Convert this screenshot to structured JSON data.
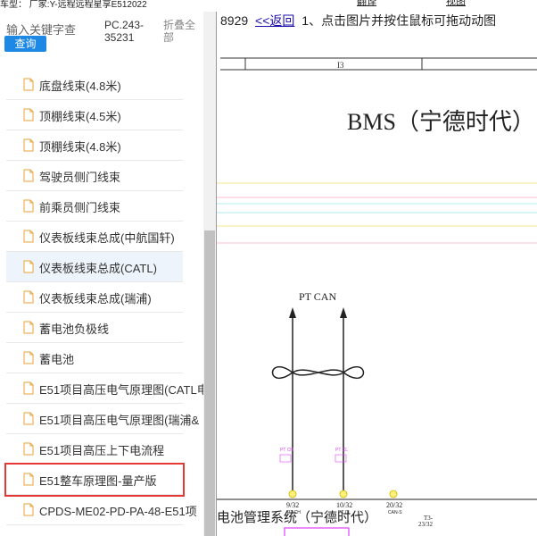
{
  "topbar": {
    "car_model": "车型： 厂家:Y-远程远程星享E512022",
    "link_a": "翻译",
    "link_b": "视图"
  },
  "search": {
    "placeholder": "输入关键字查",
    "query_label": "查询",
    "pc_code": "PC.243-35231",
    "collapse_label": "折叠全部"
  },
  "tree": {
    "items": [
      {
        "label": "底盘线束(4.8米)"
      },
      {
        "label": "顶棚线束(4.5米)"
      },
      {
        "label": "顶棚线束(4.8米)"
      },
      {
        "label": "驾驶员侧门线束"
      },
      {
        "label": "前乘员侧门线束"
      },
      {
        "label": "仪表板线束总成(中航国轩)"
      },
      {
        "label": "仪表板线束总成(CATL)"
      },
      {
        "label": "仪表板线束总成(瑞浦)"
      },
      {
        "label": "蓄电池负极线"
      },
      {
        "label": "蓄电池"
      },
      {
        "label": "E51项目高压电气原理图(CATL电"
      },
      {
        "label": "E51项目高压电气原理图(瑞浦&"
      },
      {
        "label": "E51项目高压上下电流程"
      },
      {
        "label": "E51整车原理图-量产版"
      },
      {
        "label": "CPDS-ME02-PD-PA-48-E51项"
      }
    ]
  },
  "viewer": {
    "doc_number": "8929",
    "back_label": "<<返回",
    "instruction": "1、点击图片并按住鼠标可拖动动图",
    "diagram": {
      "zone_label": "I3",
      "title": "BMS（宁德时代）",
      "can_label": "PT CAN",
      "pins": [
        {
          "num": "9/32",
          "name": "PT CH"
        },
        {
          "num": "10/32",
          "name": "PT CL"
        },
        {
          "num": "20/32",
          "name": "CAN-S"
        }
      ],
      "ref": "T3-",
      "ref2": "23/32",
      "footer": "电池管理系统（宁德时代）",
      "colors": {
        "accent": "#1e88e5",
        "highlight_box": "#e53935",
        "wire_pink": "#e040fb",
        "line_yellow": "#f0e68c",
        "line_pink": "#f8bbd0",
        "line_cyan": "#b2ebf2",
        "pin_yellow": "#fff176"
      }
    }
  }
}
